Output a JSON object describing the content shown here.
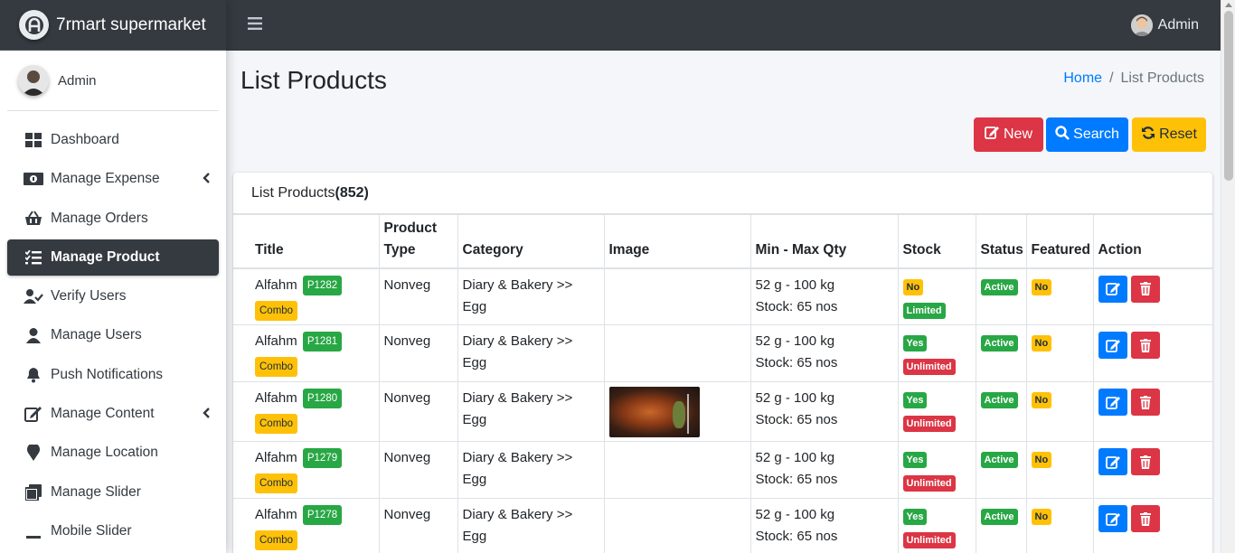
{
  "brand": {
    "name": "7rmart supermarket"
  },
  "sidebar": {
    "user_name": "Admin",
    "items": [
      {
        "label": "Dashboard",
        "icon": "dashboard-icon",
        "active": false,
        "has_arrow": false
      },
      {
        "label": "Manage Expense",
        "icon": "money-icon",
        "active": false,
        "has_arrow": true
      },
      {
        "label": "Manage Orders",
        "icon": "basket-icon",
        "active": false,
        "has_arrow": false
      },
      {
        "label": "Manage Product",
        "icon": "tasks-icon",
        "active": true,
        "has_arrow": false
      },
      {
        "label": "Verify Users",
        "icon": "user-check-icon",
        "active": false,
        "has_arrow": false
      },
      {
        "label": "Manage Users",
        "icon": "user-icon",
        "active": false,
        "has_arrow": false
      },
      {
        "label": "Push Notifications",
        "icon": "bell-icon",
        "active": false,
        "has_arrow": false
      },
      {
        "label": "Manage Content",
        "icon": "edit-icon",
        "active": false,
        "has_arrow": true
      },
      {
        "label": "Manage Location",
        "icon": "map-marker-icon",
        "active": false,
        "has_arrow": false
      },
      {
        "label": "Manage Slider",
        "icon": "slider-icon",
        "active": false,
        "has_arrow": false
      },
      {
        "label": "Mobile Slider",
        "icon": "minus-icon",
        "active": false,
        "has_arrow": false
      }
    ]
  },
  "topbar": {
    "user_name": "Admin"
  },
  "header": {
    "title": "List Products",
    "breadcrumb_home": "Home",
    "breadcrumb_sep": "/",
    "breadcrumb_current": "List Products"
  },
  "toolbar": {
    "new_label": "New",
    "search_label": "Search",
    "reset_label": "Reset"
  },
  "card": {
    "title": "List Products",
    "count": "(852)"
  },
  "table": {
    "columns": [
      "Title",
      "Product Type",
      "Category",
      "Image",
      "Min - Max Qty",
      "Stock",
      "Status",
      "Featured",
      "Action"
    ],
    "rows": [
      {
        "title": "Alfahm",
        "code": "P1282",
        "tag": "Combo",
        "type": "Nonveg",
        "category": "Diary & Bakery >> Egg",
        "has_image": false,
        "qty": "52 g - 100 kg",
        "stock_text": "Stock: 65 nos",
        "stock": "No",
        "stock_limit": "Limited",
        "status": "Active",
        "featured": "No"
      },
      {
        "title": "Alfahm",
        "code": "P1281",
        "tag": "Combo",
        "type": "Nonveg",
        "category": "Diary & Bakery >> Egg",
        "has_image": false,
        "qty": "52 g - 100 kg",
        "stock_text": "Stock: 65 nos",
        "stock": "Yes",
        "stock_limit": "Unlimited",
        "status": "Active",
        "featured": "No"
      },
      {
        "title": "Alfahm",
        "code": "P1280",
        "tag": "Combo",
        "type": "Nonveg",
        "category": "Diary & Bakery >> Egg",
        "has_image": true,
        "qty": "52 g - 100 kg",
        "stock_text": "Stock: 65 nos",
        "stock": "Yes",
        "stock_limit": "Unlimited",
        "status": "Active",
        "featured": "No"
      },
      {
        "title": "Alfahm",
        "code": "P1279",
        "tag": "Combo",
        "type": "Nonveg",
        "category": "Diary & Bakery >> Egg",
        "has_image": false,
        "qty": "52 g - 100 kg",
        "stock_text": "Stock: 65 nos",
        "stock": "Yes",
        "stock_limit": "Unlimited",
        "status": "Active",
        "featured": "No"
      },
      {
        "title": "Alfahm",
        "code": "P1278",
        "tag": "Combo",
        "type": "Nonveg",
        "category": "Diary & Bakery >> Egg",
        "has_image": false,
        "qty": "52 g - 100 kg",
        "stock_text": "Stock: 65 nos",
        "stock": "Yes",
        "stock_limit": "Unlimited",
        "status": "Active",
        "featured": "No"
      }
    ]
  },
  "colors": {
    "dark": "#343a40",
    "primary": "#007bff",
    "danger": "#dc3545",
    "warning": "#ffc107",
    "success": "#28a745"
  }
}
